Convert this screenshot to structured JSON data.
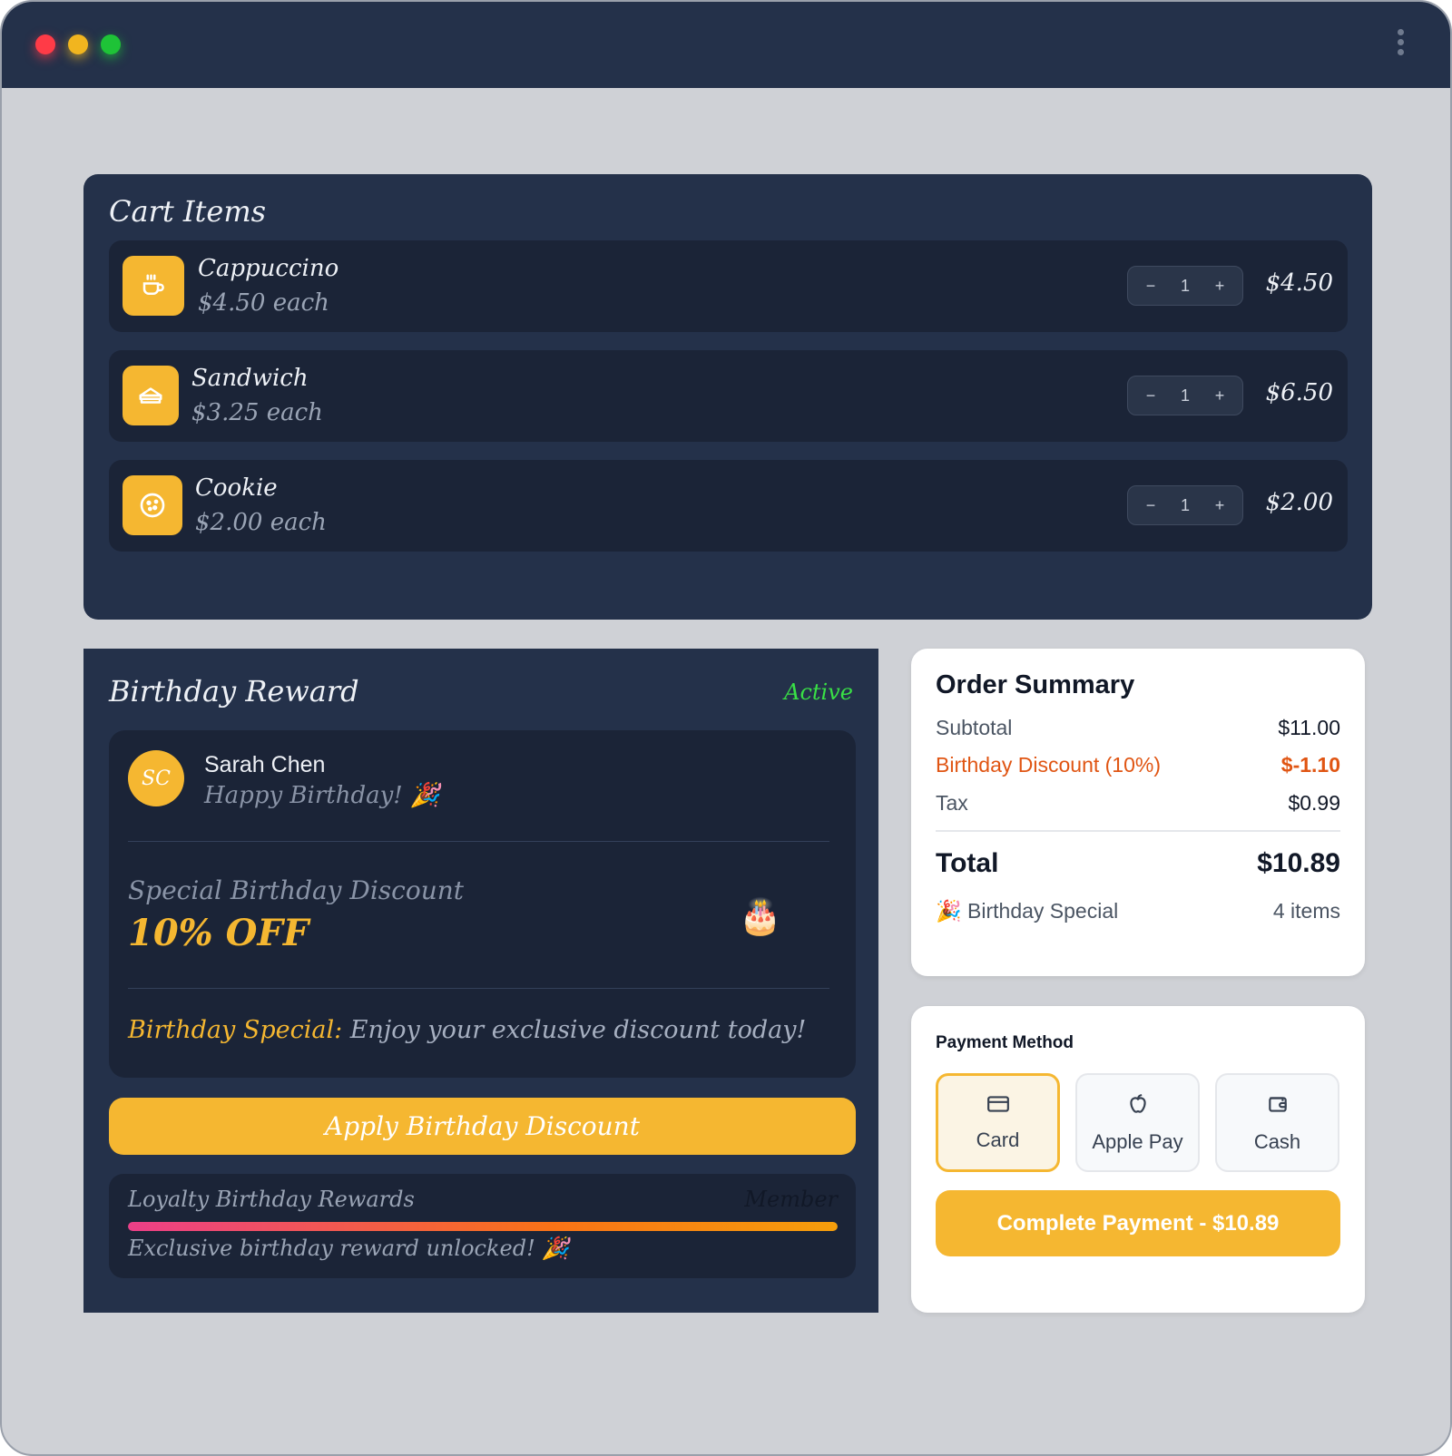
{
  "cart": {
    "title": "Cart Items",
    "items": [
      {
        "name": "Cappuccino",
        "unit": "$4.50 each",
        "qty": "1",
        "price": "$4.50",
        "icon": "coffee-cup-icon"
      },
      {
        "name": "Sandwich",
        "unit": "$3.25 each",
        "qty": "1",
        "price": "$6.50",
        "icon": "sandwich-icon"
      },
      {
        "name": "Cookie",
        "unit": "$2.00 each",
        "qty": "1",
        "price": "$2.00",
        "icon": "cookie-icon"
      }
    ],
    "minus": "−",
    "plus": "+"
  },
  "birthday": {
    "title": "Birthday Reward",
    "status": "Active",
    "status_color": "#39e046",
    "customer": {
      "initials": "SC",
      "name": "Sarah Chen",
      "message": "Happy Birthday! 🎉"
    },
    "discount_label": "Special Birthday Discount",
    "discount_value": "10% OFF",
    "cake_icon": "🎂",
    "special_key": "Birthday Special:",
    "special_text": " Enjoy your exclusive discount today!",
    "apply_button": "Apply Birthday Discount",
    "loyalty": {
      "title": "Loyalty Birthday Rewards",
      "tier": "Member",
      "progress": 1.0,
      "message": "Exclusive birthday reward unlocked! 🎉"
    }
  },
  "summary": {
    "title": "Order Summary",
    "subtotal_label": "Subtotal",
    "subtotal": "$11.00",
    "discount_label": "Birthday Discount (10%)",
    "discount": "$-1.10",
    "tax_label": "Tax",
    "tax": "$0.99",
    "total_label": "Total",
    "total": "$10.89",
    "special_label": "🎉 Birthday Special",
    "items_count": "4 items"
  },
  "payment": {
    "title": "Payment Method",
    "options": [
      {
        "label": "Card",
        "icon": "credit-card-icon",
        "selected": true
      },
      {
        "label": "Apple Pay",
        "icon": "apple-icon",
        "selected": false
      },
      {
        "label": "Cash",
        "icon": "wallet-icon",
        "selected": false
      }
    ],
    "complete_button": "Complete Payment - $10.89"
  },
  "colors": {
    "accent": "#f5b731",
    "panel": "#24314a",
    "discount": "#e05513"
  }
}
